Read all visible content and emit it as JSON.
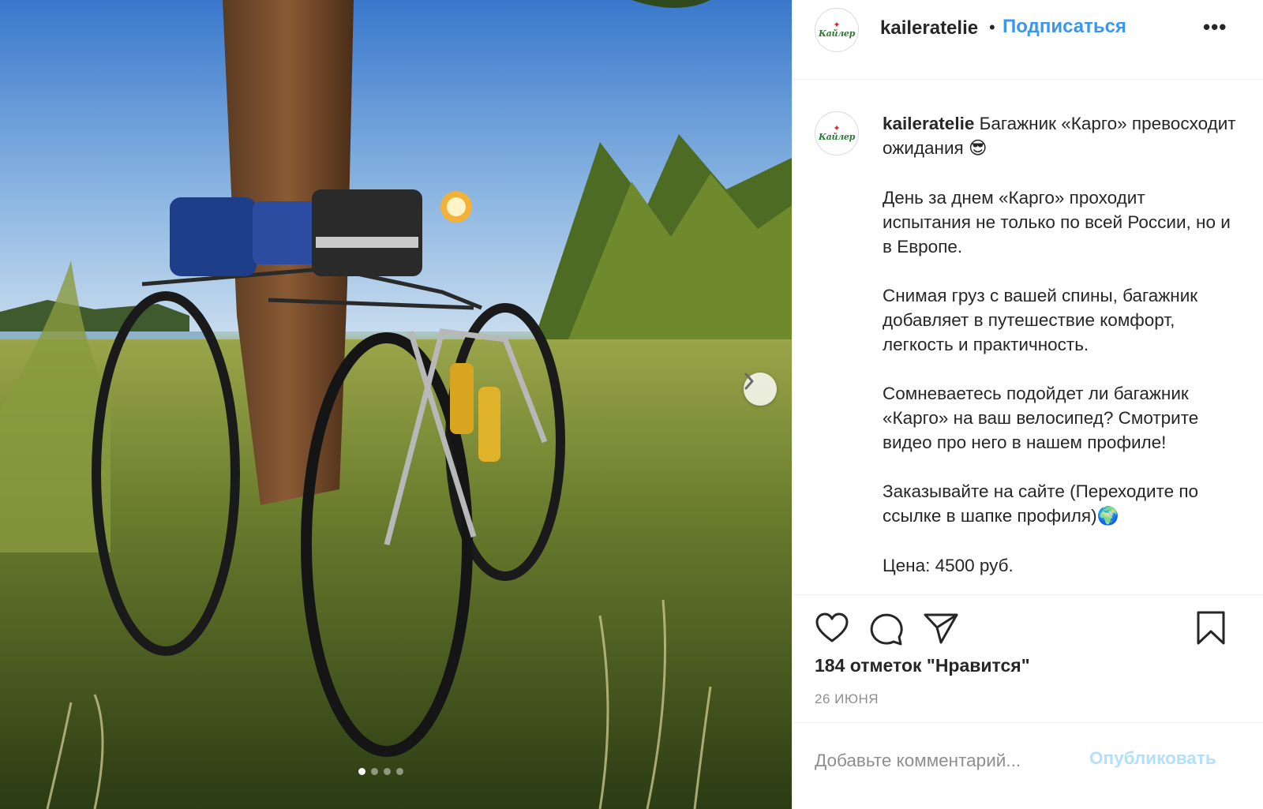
{
  "post": {
    "username": "kaileratelie",
    "avatar_text": "Кайлер",
    "follow_label": "Подписаться",
    "separator": "•",
    "more_label": "•••"
  },
  "caption": {
    "username": "kaileratelie",
    "line1": "Багажник «Карго» превосходит ожидания ",
    "line1_emoji": "😎",
    "para2": "День за днем «Карго» проходит испытания не только по всей России, но и в Европе.",
    "para3": "Снимая груз с вашей спины, багажник добавляет в путешествие комфорт, легкость и практичность.",
    "para4": "Сомневаетесь подойдет ли багажник «Карго» на ваш велосипед? Смотрите видео про него в нашем профиле!",
    "para5": "Заказывайте на сайте (Переходите по ссылке в шапке профиля)",
    "para5_emoji": "🌍",
    "para6": "Цена: 4500 руб."
  },
  "stats": {
    "likes": "184 отметок \"Нравится\"",
    "date": "26 ИЮНЯ"
  },
  "comment": {
    "placeholder": "Добавьте комментарий...",
    "publish_label": "Опубликовать"
  },
  "carousel": {
    "total": 4,
    "active": 1
  },
  "icons": {
    "like": "heart-icon",
    "comment": "comment-bubble-icon",
    "share": "paper-plane-icon",
    "save": "bookmark-icon",
    "next": "chevron-right-icon"
  }
}
